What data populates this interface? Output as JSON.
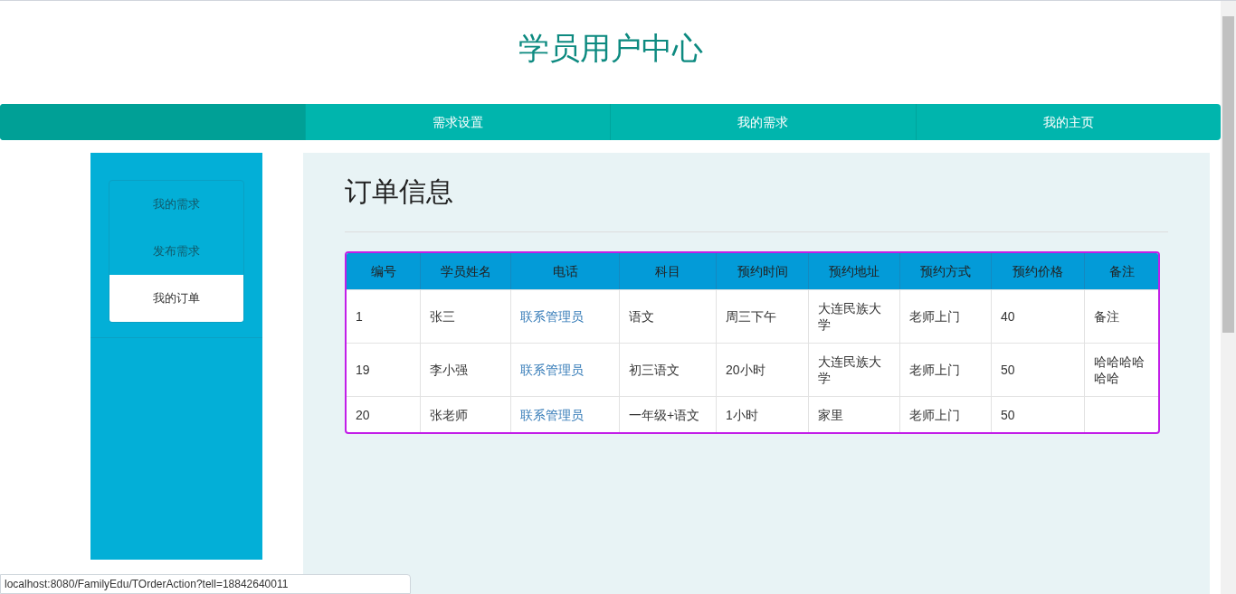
{
  "header": {
    "title": "学员用户中心"
  },
  "nav": {
    "items": [
      {
        "label": "需求设置"
      },
      {
        "label": "我的需求"
      },
      {
        "label": "我的主页"
      }
    ]
  },
  "sidebar": {
    "items": [
      {
        "label": "我的需求",
        "selected": false
      },
      {
        "label": "发布需求",
        "selected": false
      },
      {
        "label": "我的订单",
        "selected": true
      }
    ]
  },
  "content": {
    "heading": "订单信息"
  },
  "table": {
    "columns": [
      "编号",
      "学员姓名",
      "电话",
      "科目",
      "预约时间",
      "预约地址",
      "预约方式",
      "预约价格",
      "备注"
    ],
    "rows": [
      [
        "1",
        "张三",
        "联系管理员",
        "语文",
        "周三下午",
        "大连民族大学",
        "老师上门",
        "40",
        "备注"
      ],
      [
        "19",
        "李小强",
        "联系管理员",
        "初三语文",
        "20小时",
        "大连民族大学",
        "老师上门",
        "50",
        "哈哈哈哈哈哈"
      ],
      [
        "20",
        "张老师",
        "联系管理员",
        "一年级+语文",
        "1小时",
        "家里",
        "老师上门",
        "50",
        ""
      ]
    ]
  },
  "status_bar": {
    "url": "localhost:8080/FamilyEdu/TOrderAction?tell=18842640011"
  }
}
